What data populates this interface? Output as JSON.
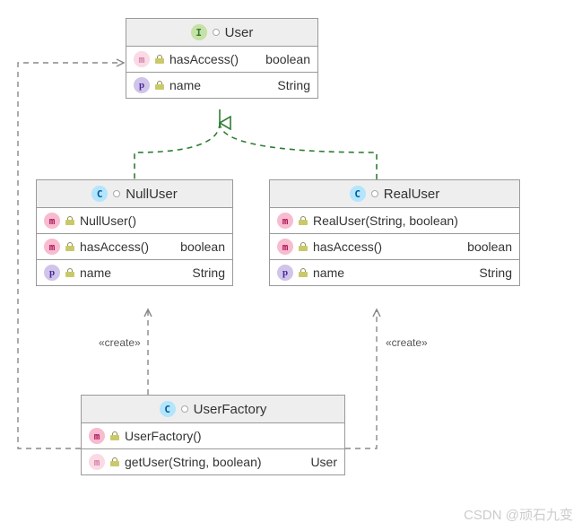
{
  "watermark": "CSDN @顽石九变",
  "stereotype_create": "«create»",
  "classes": {
    "user": {
      "name": "User",
      "kind": "interface",
      "members": [
        {
          "icon": "m",
          "faded": true,
          "name": "hasAccess()",
          "type": "boolean"
        },
        {
          "icon": "p",
          "faded": false,
          "name": "name",
          "type": "String"
        }
      ]
    },
    "nullUser": {
      "name": "NullUser",
      "kind": "class",
      "members": [
        {
          "icon": "m",
          "faded": false,
          "name": "NullUser()",
          "type": ""
        },
        {
          "icon": "m",
          "faded": false,
          "name": "hasAccess()",
          "type": "boolean"
        },
        {
          "icon": "p",
          "faded": false,
          "name": "name",
          "type": "String"
        }
      ]
    },
    "realUser": {
      "name": "RealUser",
      "kind": "class",
      "members": [
        {
          "icon": "m",
          "faded": false,
          "name": "RealUser(String, boolean)",
          "type": ""
        },
        {
          "icon": "m",
          "faded": false,
          "name": "hasAccess()",
          "type": "boolean"
        },
        {
          "icon": "p",
          "faded": false,
          "name": "name",
          "type": "String"
        }
      ]
    },
    "userFactory": {
      "name": "UserFactory",
      "kind": "class",
      "members": [
        {
          "icon": "m",
          "faded": false,
          "name": "UserFactory()",
          "type": ""
        },
        {
          "icon": "m",
          "faded": true,
          "name": "getUser(String, boolean)",
          "type": "User"
        }
      ]
    }
  }
}
